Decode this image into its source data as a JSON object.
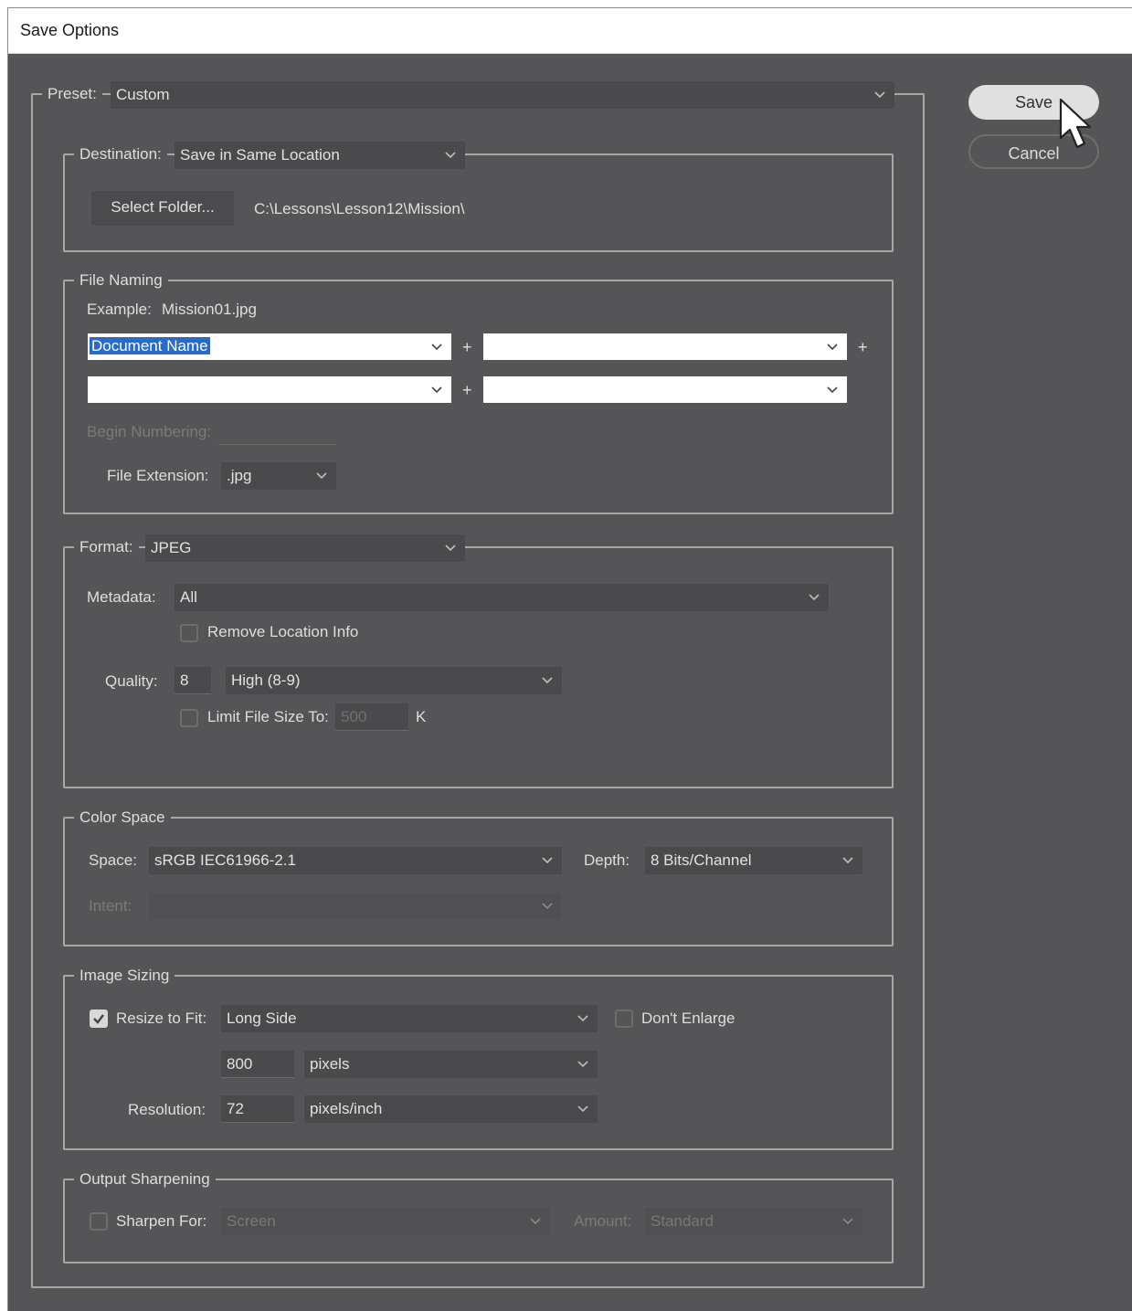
{
  "window": {
    "title": "Save Options"
  },
  "buttons": {
    "save": "Save",
    "cancel": "Cancel"
  },
  "preset": {
    "label": "Preset:",
    "value": "Custom"
  },
  "destination": {
    "label": "Destination:",
    "value": "Save in Same Location",
    "select_folder": "Select Folder...",
    "path": "C:\\Lessons\\Lesson12\\Mission\\"
  },
  "file_naming": {
    "legend": "File Naming",
    "example_label": "Example:",
    "example_value": "Mission01.jpg",
    "field1": "Document Name",
    "field2": "",
    "field3": "",
    "field4": "",
    "plus": "+",
    "begin_numbering": "Begin Numbering:",
    "extension_label": "File Extension:",
    "extension_value": ".jpg"
  },
  "format": {
    "label": "Format:",
    "value": "JPEG",
    "metadata_label": "Metadata:",
    "metadata_value": "All",
    "remove_location": "Remove Location Info",
    "remove_location_checked": false,
    "quality_label": "Quality:",
    "quality_value": "8",
    "quality_preset": "High  (8-9)",
    "limit_label": "Limit File Size To:",
    "limit_value": "500",
    "limit_unit": "K",
    "limit_checked": false
  },
  "color_space": {
    "legend": "Color Space",
    "space_label": "Space:",
    "space_value": "sRGB IEC61966-2.1",
    "depth_label": "Depth:",
    "depth_value": "8 Bits/Channel",
    "intent_label": "Intent:",
    "intent_value": ""
  },
  "image_sizing": {
    "legend": "Image Sizing",
    "resize_label": "Resize to Fit:",
    "resize_checked": true,
    "resize_value": "Long Side",
    "dont_enlarge": "Don't Enlarge",
    "dont_enlarge_checked": false,
    "size_value": "800",
    "size_unit": "pixels",
    "resolution_label": "Resolution:",
    "resolution_value": "72",
    "resolution_unit": "pixels/inch"
  },
  "output_sharpening": {
    "legend": "Output Sharpening",
    "sharpen_label": "Sharpen For:",
    "sharpen_checked": false,
    "sharpen_value": "Screen",
    "amount_label": "Amount:",
    "amount_value": "Standard"
  },
  "icons": {
    "chevron": "chevron-down-icon",
    "checkmark": "checkmark-icon",
    "cursor": "mouse-cursor-icon"
  },
  "colors": {
    "dialog_bg": "#555557",
    "field_bg": "#4a4a4c",
    "group_border": "#a8a8a8",
    "selection": "#2a6bc8"
  }
}
